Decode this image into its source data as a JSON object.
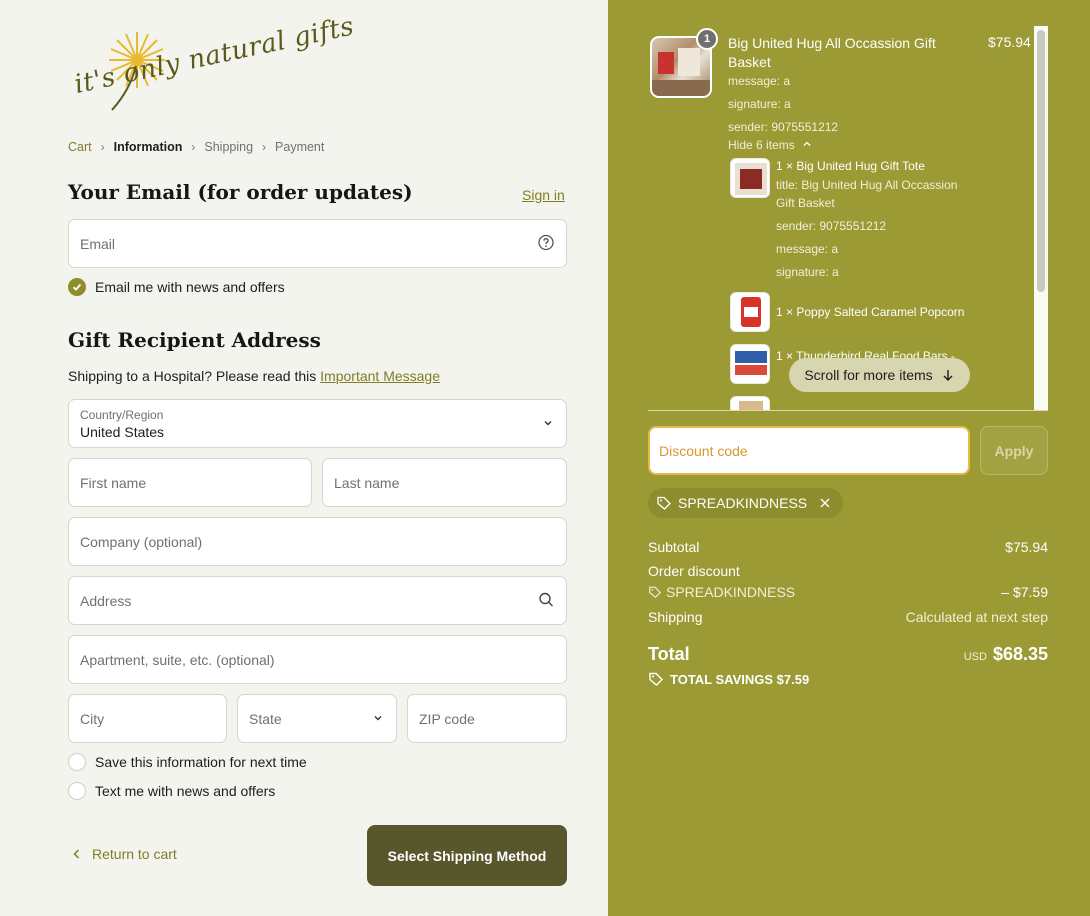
{
  "brand": {
    "logo_text": "it's only natural gifts"
  },
  "breadcrumb": [
    "Cart",
    "Information",
    "Shipping",
    "Payment"
  ],
  "contact": {
    "heading": "Your Email (for order updates)",
    "sign_in": "Sign in",
    "email_placeholder": "Email",
    "news_label": "Email me with news and offers",
    "news_checked": true
  },
  "address": {
    "heading": "Gift Recipient Address",
    "hospital_text": "Shipping to a Hospital? Please read this",
    "hospital_link": "Important Message",
    "country_label": "Country/Region",
    "country_value": "United States",
    "first_name": "First name",
    "last_name": "Last name",
    "company": "Company (optional)",
    "address": "Address",
    "apartment": "Apartment, suite, etc. (optional)",
    "city": "City",
    "state": "State",
    "zip": "ZIP code",
    "save_info": "Save this information for next time",
    "text_news": "Text me with news and offers"
  },
  "actions": {
    "return": "Return to cart",
    "continue": "Select Shipping Method"
  },
  "order": {
    "item": {
      "quantity": "1",
      "title": "Big United Hug All Occassion Gift Basket",
      "price": "$75.94",
      "message": "message: a",
      "signature": "signature: a",
      "sender": "sender: 9075551212",
      "toggle": "Hide 6 items"
    },
    "sub_items": [
      {
        "title": "1 × Big United Hug Gift Tote",
        "meta1": "title: Big United Hug All Occassion Gift Basket",
        "meta2": "sender: 9075551212",
        "meta3": "message: a",
        "meta4": "signature: a"
      },
      {
        "title": "1 × Poppy Salted Caramel Popcorn"
      },
      {
        "title": "1 × Thunderbird Real Food Bars -"
      }
    ],
    "scroll_hint": "Scroll for more items",
    "discount_placeholder": "Discount code",
    "apply": "Apply",
    "applied_code": "SPREADKINDNESS",
    "subtotal_label": "Subtotal",
    "subtotal_value": "$75.94",
    "order_discount_label": "Order discount",
    "discount_code": "SPREADKINDNESS",
    "discount_value": "– $7.59",
    "shipping_label": "Shipping",
    "shipping_value": "Calculated at next step",
    "total_label": "Total",
    "currency": "USD",
    "total_value": "$68.35",
    "savings": "TOTAL SAVINGS $7.59"
  }
}
